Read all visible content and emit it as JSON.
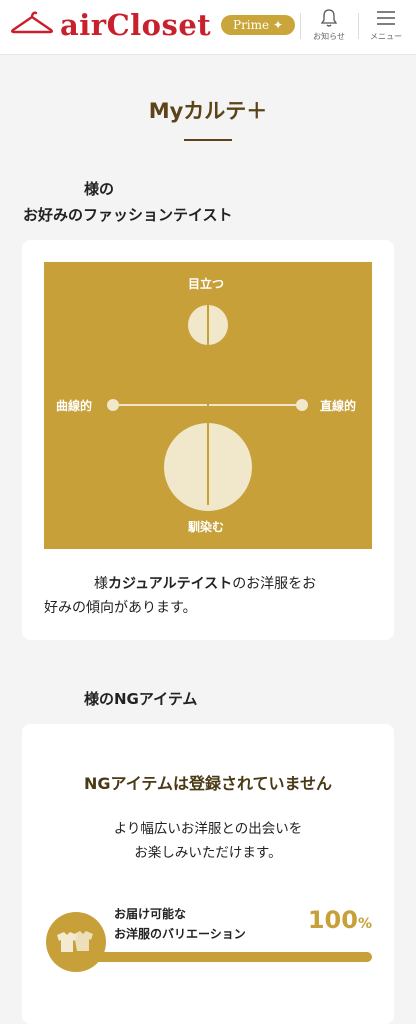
{
  "header": {
    "logo": "airCloset",
    "plan_badge": "Prime",
    "notifications": {
      "label": "お知らせ",
      "icon": "bell-icon"
    },
    "menu": {
      "label": "メニュー",
      "icon": "hamburger-menu-icon"
    }
  },
  "page": {
    "title": "Myカルテ＋"
  },
  "taste": {
    "heading_line1": "様の",
    "heading_line2": "お好みのファッションテイスト",
    "map": {
      "top": "目立つ",
      "bottom": "馴染む",
      "left": "曲線的",
      "right": "直線的"
    },
    "result_prefix": "様",
    "result_taste": "カジュアルテイスト",
    "result_suffix": "のお洋服をお",
    "result_line2": "好みの傾向があります。"
  },
  "ng": {
    "heading": "様のNGアイテム",
    "title": "NGアイテムは登録されていません",
    "desc_line1": "より幅広いお洋服との出会いを",
    "desc_line2": "お楽しみいただけます。",
    "variation_label_line1": "お届け可能な",
    "variation_label_line2": "お洋服のバリエーション",
    "variation_value": "100",
    "variation_unit": "%",
    "variation_fraction": 1.0,
    "variation_icon": "clothes-icon"
  },
  "colors": {
    "brand_red": "#c8202c",
    "gold": "#c8a03a",
    "dark_brown": "#5a4418",
    "page_background": "#f4f4f4"
  }
}
